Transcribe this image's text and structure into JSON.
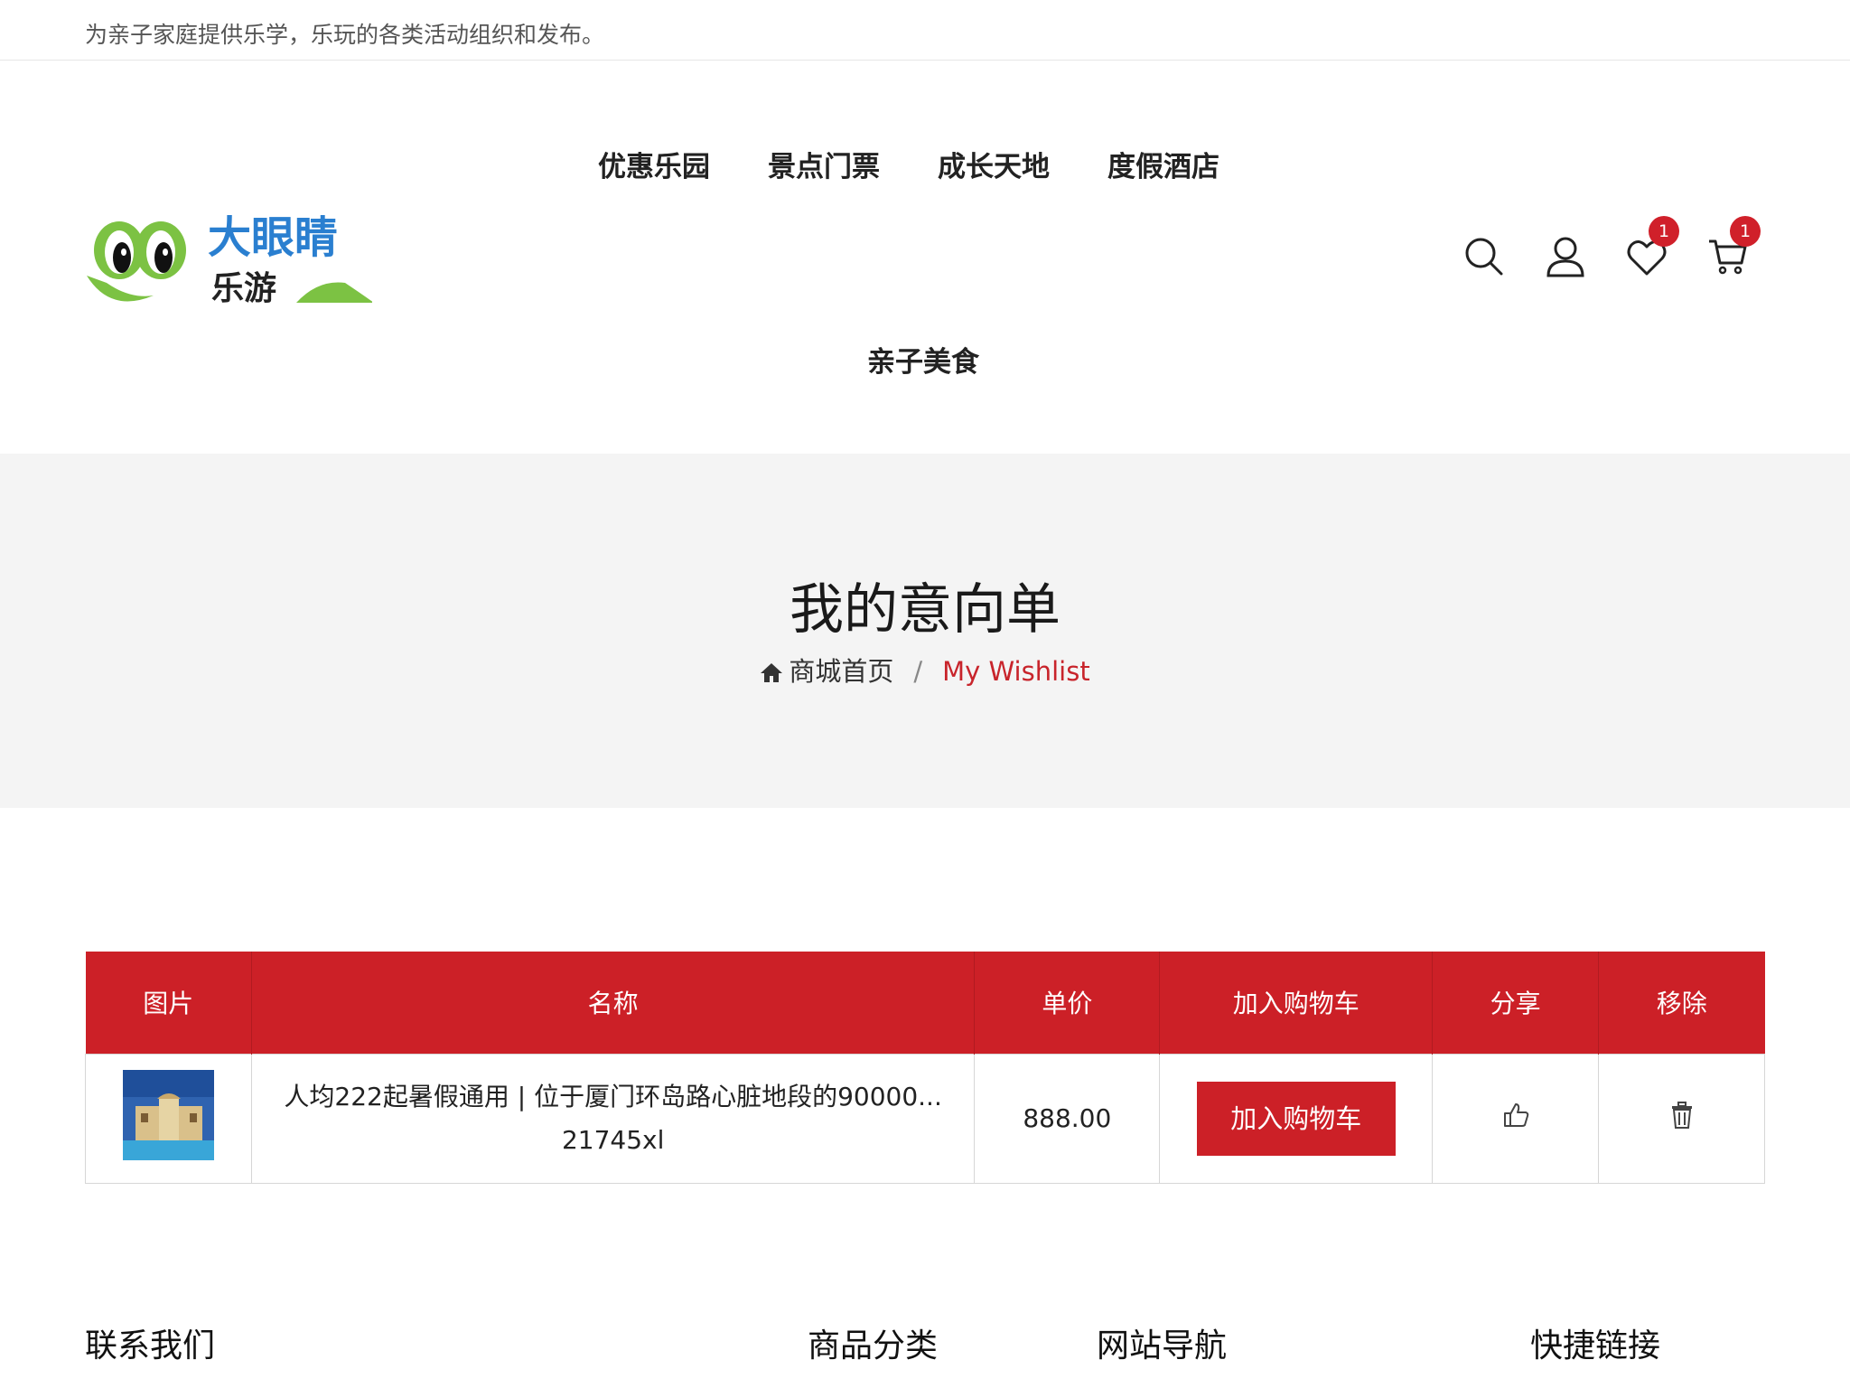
{
  "topbar": {
    "tagline": "为亲子家庭提供乐学，乐玩的各类活动组织和发布。"
  },
  "logo": {
    "line1": "大眼睛",
    "line2": "乐游"
  },
  "nav": {
    "items": [
      "优惠乐园",
      "景点门票",
      "成长天地",
      "度假酒店",
      "亲子美食"
    ]
  },
  "header_icons": {
    "wishlist_count": "1",
    "cart_count": "1"
  },
  "banner": {
    "title": "我的意向单",
    "breadcrumb_home": "商城首页",
    "breadcrumb_sep": "/",
    "breadcrumb_current": "My Wishlist"
  },
  "table": {
    "headers": [
      "图片",
      "名称",
      "单价",
      "加入购物车",
      "分享",
      "移除"
    ],
    "row": {
      "name_line1": "人均222起暑假通用 | 位于厦门环岛路心脏地段的90000...",
      "name_line2": "21745xl",
      "price": "888.00",
      "add_label": "加入购物车"
    }
  },
  "footer": {
    "headings": [
      "联系我们",
      "商品分类",
      "网站导航",
      "快捷链接"
    ]
  },
  "colors": {
    "accent": "#cc2027"
  }
}
